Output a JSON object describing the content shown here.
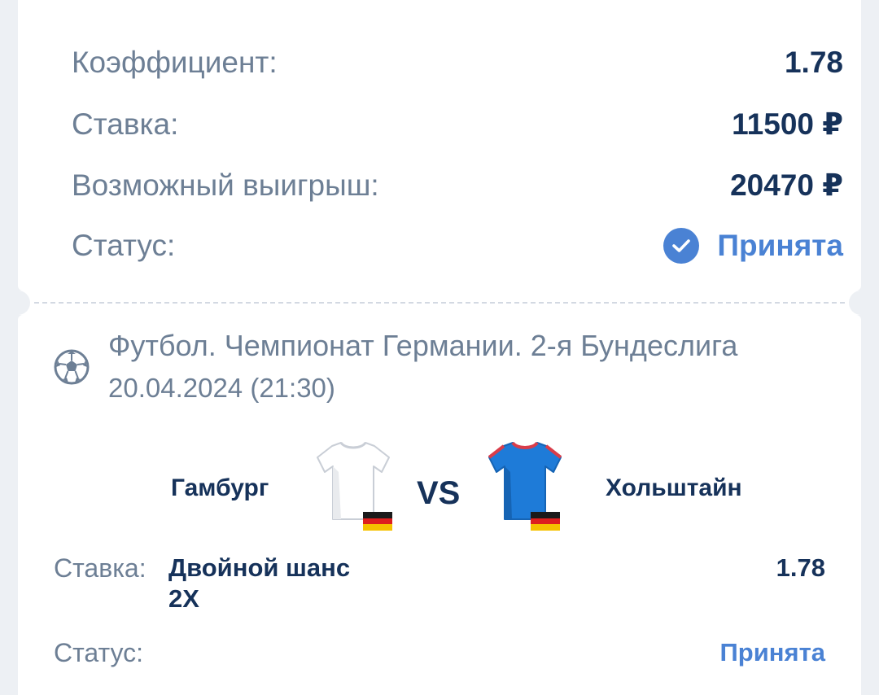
{
  "summary": {
    "odds_label": "Коэффициент:",
    "odds_value": "1.78",
    "stake_label": "Ставка:",
    "stake_value": "11500 ₽",
    "payout_label": "Возможный выигрыш:",
    "payout_value": "20470 ₽",
    "status_label": "Статус:",
    "status_value": "Принята",
    "status_icon": "check-circle-icon"
  },
  "event": {
    "sport_icon": "soccer-ball-icon",
    "league": "Футбол. Чемпионат Германии. 2-я Бундеслига",
    "datetime": "20.04.2024 (21:30)",
    "home_team": "Гамбург",
    "away_team": "Хольштайн",
    "vs": "VS",
    "home_shirt_color": "#ffffff",
    "away_shirt_color": "#1e7bd8",
    "flag_icon": "germany-flag-icon"
  },
  "selection": {
    "stake_label": "Ставка:",
    "market": "Двойной шанс",
    "outcome": "2X",
    "odds": "1.78",
    "status_label": "Статус:",
    "status_value": "Принята"
  },
  "colors": {
    "label": "#6d7f95",
    "value": "#16325a",
    "accent": "#4a82d4",
    "background": "#edf0f4"
  }
}
